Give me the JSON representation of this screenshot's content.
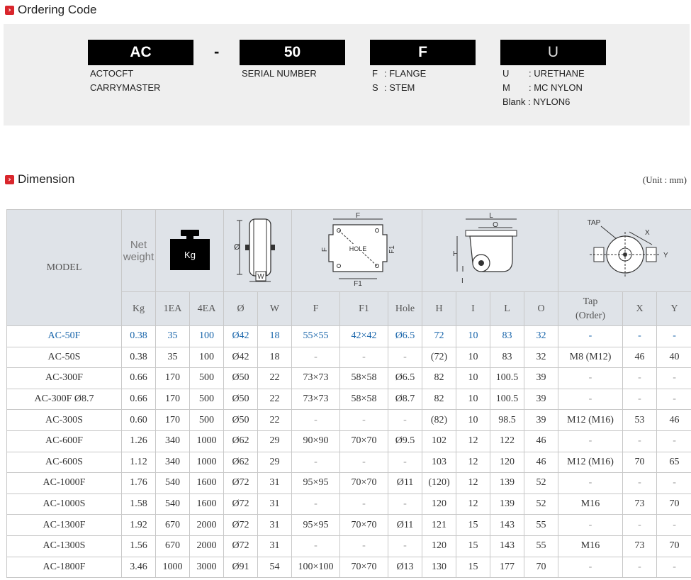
{
  "sections": {
    "ordering_title": "Ordering Code",
    "dimension_title": "Dimension",
    "unit_text": "(Unit : mm)"
  },
  "ordering_code": {
    "dash": "-",
    "boxes": [
      "AC",
      "50",
      "F",
      "U"
    ],
    "desc": {
      "ac": [
        "ACTOCFT",
        "CARRYMASTER"
      ],
      "serial": "SERIAL NUMBER",
      "mount": [
        {
          "key": "F",
          "value": ": FLANGE"
        },
        {
          "key": "S",
          "value": ": STEM"
        }
      ],
      "material": [
        {
          "key": "U",
          "value": ": URETHANE"
        },
        {
          "key": "M",
          "value": ": MC NYLON"
        },
        {
          "key": "Blank",
          "value": ": NYLON6"
        }
      ]
    }
  },
  "table": {
    "model_header": "MODEL",
    "net_weight_header": "Net weight",
    "weight_icon_label": "Kg",
    "diagram_labels": {
      "wheel": {
        "d": "Ø",
        "w": "W"
      },
      "flange": {
        "f": "F",
        "f1": "F1",
        "hole": "HOLE"
      },
      "side": {
        "l": "L",
        "o": "O",
        "h": "H",
        "i": "I"
      },
      "top": {
        "tap": "TAP",
        "x": "X",
        "y": "Y"
      }
    },
    "subheaders": [
      "Kg",
      "1EA",
      "4EA",
      "Ø",
      "W",
      "F",
      "F1",
      "Hole",
      "H",
      "I",
      "L",
      "O",
      "Tap (Order)",
      "X",
      "Y"
    ],
    "rows": [
      [
        "AC-50F",
        "0.38",
        "35",
        "100",
        "Ø42",
        "18",
        "55×55",
        "42×42",
        "Ø6.5",
        "72",
        "10",
        "83",
        "32",
        "-",
        "-",
        "-"
      ],
      [
        "AC-50S",
        "0.38",
        "35",
        "100",
        "Ø42",
        "18",
        "-",
        "-",
        "-",
        "(72)",
        "10",
        "83",
        "32",
        "M8 (M12)",
        "46",
        "40"
      ],
      [
        "AC-300F",
        "0.66",
        "170",
        "500",
        "Ø50",
        "22",
        "73×73",
        "58×58",
        "Ø6.5",
        "82",
        "10",
        "100.5",
        "39",
        "-",
        "-",
        "-"
      ],
      [
        "AC-300F Ø8.7",
        "0.66",
        "170",
        "500",
        "Ø50",
        "22",
        "73×73",
        "58×58",
        "Ø8.7",
        "82",
        "10",
        "100.5",
        "39",
        "-",
        "-",
        "-"
      ],
      [
        "AC-300S",
        "0.60",
        "170",
        "500",
        "Ø50",
        "22",
        "-",
        "-",
        "-",
        "(82)",
        "10",
        "98.5",
        "39",
        "M12 (M16)",
        "53",
        "46"
      ],
      [
        "AC-600F",
        "1.26",
        "340",
        "1000",
        "Ø62",
        "29",
        "90×90",
        "70×70",
        "Ø9.5",
        "102",
        "12",
        "122",
        "46",
        "-",
        "-",
        "-"
      ],
      [
        "AC-600S",
        "1.12",
        "340",
        "1000",
        "Ø62",
        "29",
        "-",
        "-",
        "-",
        "103",
        "12",
        "120",
        "46",
        "M12 (M16)",
        "70",
        "65"
      ],
      [
        "AC-1000F",
        "1.76",
        "540",
        "1600",
        "Ø72",
        "31",
        "95×95",
        "70×70",
        "Ø11",
        "(120)",
        "12",
        "139",
        "52",
        "-",
        "-",
        "-"
      ],
      [
        "AC-1000S",
        "1.58",
        "540",
        "1600",
        "Ø72",
        "31",
        "-",
        "-",
        "-",
        "120",
        "12",
        "139",
        "52",
        "M16",
        "73",
        "70"
      ],
      [
        "AC-1300F",
        "1.92",
        "670",
        "2000",
        "Ø72",
        "31",
        "95×95",
        "70×70",
        "Ø11",
        "121",
        "15",
        "143",
        "55",
        "-",
        "-",
        "-"
      ],
      [
        "AC-1300S",
        "1.56",
        "670",
        "2000",
        "Ø72",
        "31",
        "-",
        "-",
        "-",
        "120",
        "15",
        "143",
        "55",
        "M16",
        "73",
        "70"
      ],
      [
        "AC-1800F",
        "3.46",
        "1000",
        "3000",
        "Ø91",
        "54",
        "100×100",
        "70×70",
        "Ø13",
        "130",
        "15",
        "177",
        "70",
        "-",
        "-",
        "-"
      ]
    ]
  },
  "colors": {
    "accent": "#d9262c",
    "header_bg": "#dfe3e8",
    "highlight": "#1764aa",
    "panel_bg": "#efefef"
  }
}
